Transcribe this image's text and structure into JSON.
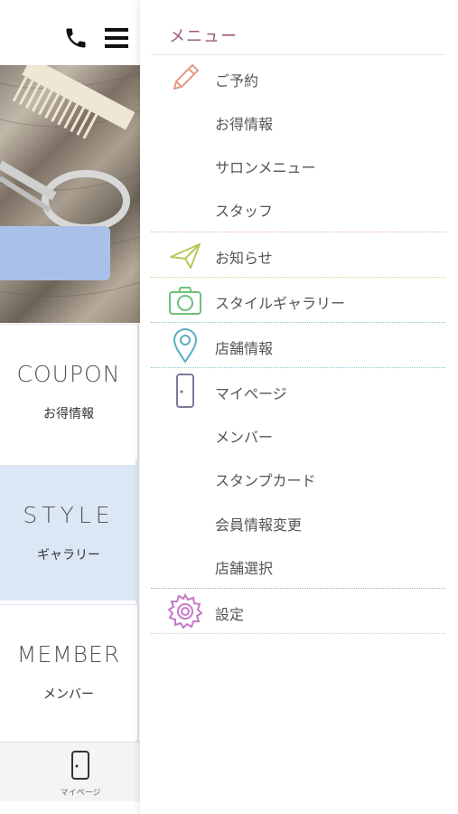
{
  "header": {
    "phone_icon": "phone-icon",
    "menu_icon": "hamburger-icon"
  },
  "tiles": [
    {
      "en": "COUPON",
      "ja": "お得情報"
    },
    {
      "en": "STYLE",
      "ja": "ギャラリー"
    },
    {
      "en": "MEMBER",
      "ja": "メンバー"
    }
  ],
  "bottom_nav": {
    "label": "マイページ",
    "icon": "door-icon"
  },
  "drawer": {
    "title": "メニュー",
    "items": [
      {
        "label": "ご予約",
        "icon": "pencil-icon"
      },
      {
        "label": "お得情報"
      },
      {
        "label": "サロンメニュー"
      },
      {
        "label": "スタッフ"
      },
      {
        "label": "お知らせ",
        "icon": "paper-plane-icon"
      },
      {
        "label": "スタイルギャラリー",
        "icon": "camera-icon"
      },
      {
        "label": "店舗情報",
        "icon": "map-pin-icon"
      },
      {
        "label": "マイページ",
        "icon": "door-icon"
      },
      {
        "label": "メンバー"
      },
      {
        "label": "スタンプカード"
      },
      {
        "label": "会員情報変更"
      },
      {
        "label": "店舗選択"
      },
      {
        "label": "設定",
        "icon": "gear-icon"
      }
    ]
  },
  "colors": {
    "accent_title": "#9a5a7e",
    "pencil": "#e49a86",
    "plane": "#b6c95a",
    "camera": "#6fc07a",
    "pin": "#5aaec0",
    "door": "#7b7a9a",
    "gear": "#c879c8",
    "style_tile_bg": "#dce7f6"
  }
}
